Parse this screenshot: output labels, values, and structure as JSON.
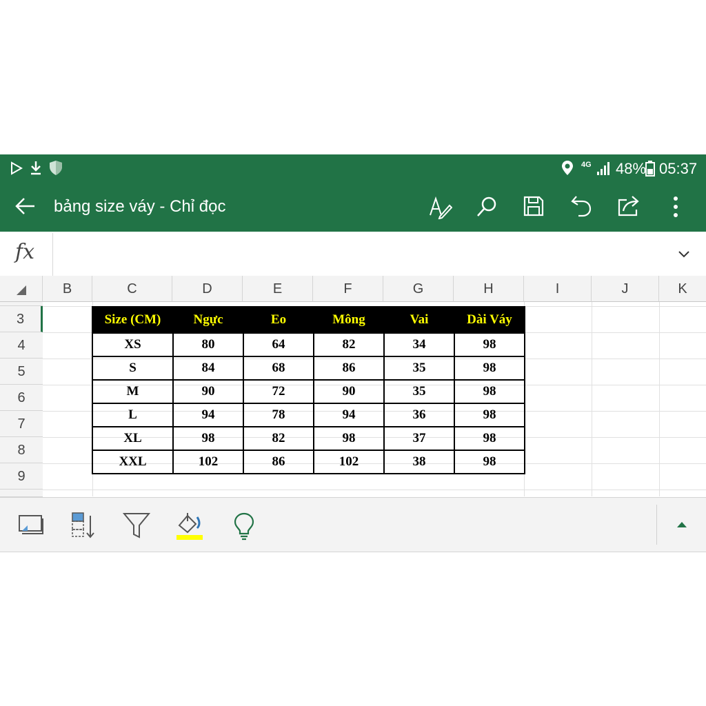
{
  "status_bar": {
    "network": "4G",
    "battery": "48%",
    "time": "05:37"
  },
  "app_bar": {
    "title": "bảng size váy - Chỉ đọc"
  },
  "formula_bar": {
    "fx_label": "fx",
    "value": ""
  },
  "columns": [
    "B",
    "C",
    "D",
    "E",
    "F",
    "G",
    "H",
    "I",
    "J",
    "K"
  ],
  "rows": [
    "3",
    "4",
    "5",
    "6",
    "7",
    "8",
    "9"
  ],
  "table": {
    "headers": [
      "Size (CM)",
      "Ngực",
      "Eo",
      "Mông",
      "Vai",
      "Dài Váy"
    ],
    "rows": [
      [
        "XS",
        "80",
        "64",
        "82",
        "34",
        "98"
      ],
      [
        "S",
        "84",
        "68",
        "86",
        "35",
        "98"
      ],
      [
        "M",
        "90",
        "72",
        "90",
        "35",
        "98"
      ],
      [
        "L",
        "94",
        "78",
        "94",
        "36",
        "98"
      ],
      [
        "XL",
        "98",
        "82",
        "98",
        "37",
        "98"
      ],
      [
        "XXL",
        "102",
        "86",
        "102",
        "38",
        "98"
      ]
    ]
  },
  "colors": {
    "accent": "#217346",
    "header_bg": "#000000",
    "header_text": "#ffff00",
    "highlight": "#ffff00"
  },
  "icons": [
    "back-arrow-icon",
    "draw-icon",
    "search-icon",
    "save-icon",
    "undo-icon",
    "share-icon",
    "more-icon",
    "select-icon",
    "sort-icon",
    "filter-icon",
    "fill-color-icon",
    "tell-me-icon",
    "expand-icon"
  ]
}
